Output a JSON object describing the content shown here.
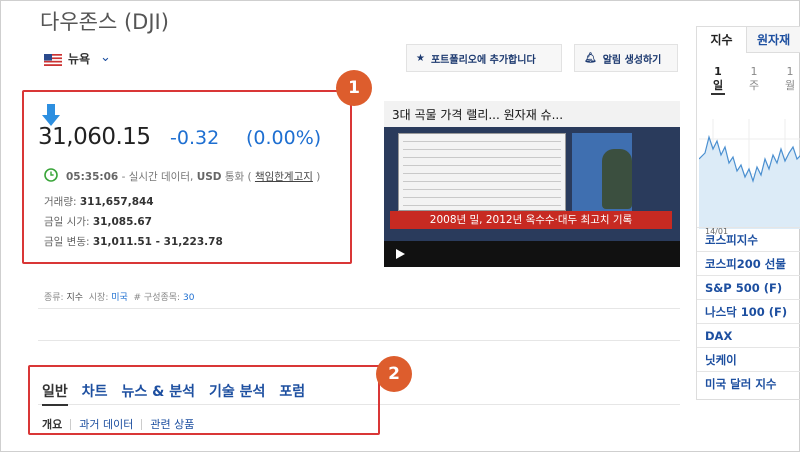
{
  "header": {
    "title": "다우존스 (DJI)"
  },
  "exchange": {
    "label": "뉴욕"
  },
  "actions": {
    "portfolio_label": "포트폴리오에 추가합니다",
    "alert_label": "알림 생성하기"
  },
  "quote": {
    "price": "31,060.15",
    "change": "-0.32",
    "change_pct": "(0.00%)",
    "time": "05:35:06",
    "realtime_text": "- 실시간 데이터,",
    "currency": "USD",
    "currency_suffix": "통화 (",
    "disclaimer_link": "책임한계고지",
    "disclaimer_close": ")"
  },
  "stats": [
    {
      "label": "거래량:",
      "value": "311,657,844"
    },
    {
      "label": "금일 시가:",
      "value": "31,085.67"
    },
    {
      "label": "금일 변동:",
      "value": "31,011.51 - 31,223.78"
    }
  ],
  "video": {
    "headline": "3대 곡물 가격 랠리... 원자재 슈...",
    "caption": "2008년 밀, 2012년 옥수수·대두 최고치 기록"
  },
  "meta": {
    "type_label": "종류:",
    "type_value": "지수",
    "market_label": "시장:",
    "market_value": "미국",
    "components_label": "# 구성종목:",
    "components_value": "30"
  },
  "tabs": [
    {
      "label": "일반"
    },
    {
      "label": "차트"
    },
    {
      "label": "뉴스 & 분석"
    },
    {
      "label": "기술 분석"
    },
    {
      "label": "포럼"
    }
  ],
  "subtabs": [
    {
      "label": "개요"
    },
    {
      "label": "과거 데이터"
    },
    {
      "label": "관련 상품"
    }
  ],
  "annotations": {
    "one": "1",
    "two": "2"
  },
  "right_panel": {
    "tab_indices": "지수",
    "tab_commodities": "원자재",
    "periods": [
      {
        "n": "1",
        "u": "일"
      },
      {
        "n": "1",
        "u": "주"
      },
      {
        "n": "1",
        "u": "월"
      }
    ],
    "date_label": "14/01",
    "indices": [
      "코스피지수",
      "코스피200 선물",
      "S&P 500 (F)",
      "나스닥 100 (F)",
      "DAX",
      "닛케이",
      "미국 달러 지수"
    ]
  },
  "colors": {
    "accent": "#1e6fd1",
    "highlight": "#d93636",
    "badge": "#dd5d2d"
  }
}
